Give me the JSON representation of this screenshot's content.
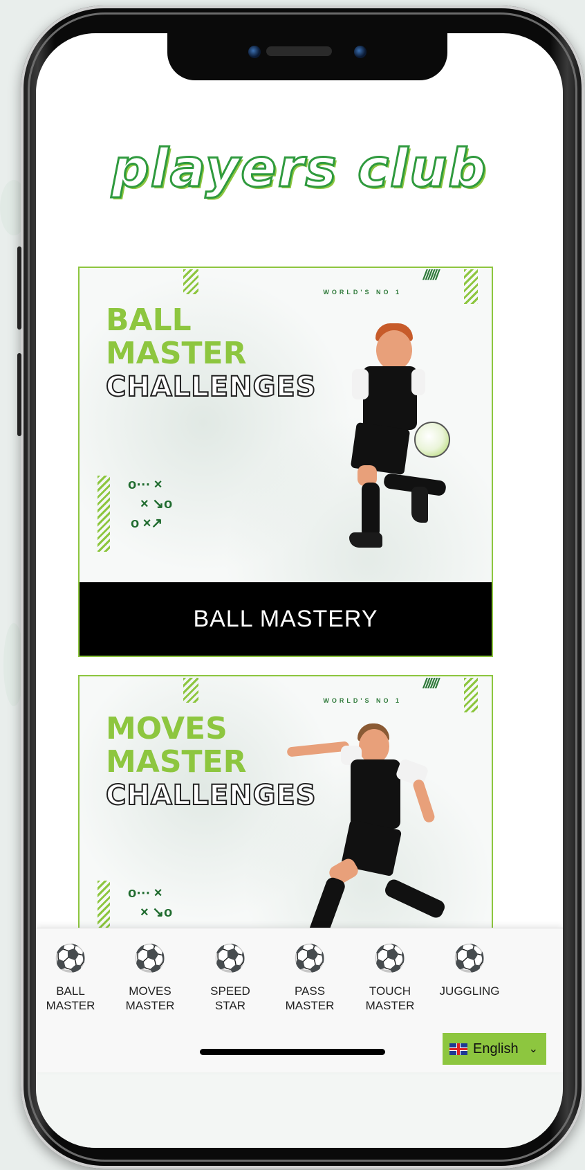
{
  "app": {
    "logo_text": "players club"
  },
  "cards": [
    {
      "headline_line1": "BALL",
      "headline_line2": "MASTER",
      "headline_line3": "CHALLENGES",
      "badge": "WORLD'S NO 1",
      "caption": "BALL MASTERY"
    },
    {
      "headline_line1": "MOVES",
      "headline_line2": "MASTER",
      "headline_line3": "CHALLENGES",
      "badge": "WORLD'S NO 1",
      "caption": ""
    }
  ],
  "nav": {
    "items": [
      {
        "label": "BALL\nMASTER",
        "icon": "soccer-ball-icon"
      },
      {
        "label": "MOVES\nMASTER",
        "icon": "soccer-ball-icon"
      },
      {
        "label": "SPEED\nSTAR",
        "icon": "soccer-ball-icon"
      },
      {
        "label": "PASS\nMASTER",
        "icon": "soccer-ball-icon"
      },
      {
        "label": "TOUCH\nMASTER",
        "icon": "soccer-ball-icon"
      },
      {
        "label": "JUGGLING",
        "icon": "soccer-ball-icon"
      }
    ]
  },
  "language": {
    "selected": "English",
    "flag_icon": "uk-flag-icon"
  },
  "colors": {
    "brand_green": "#8dc63f",
    "dark_green": "#2f9a3e",
    "caption_bg": "#000000"
  }
}
